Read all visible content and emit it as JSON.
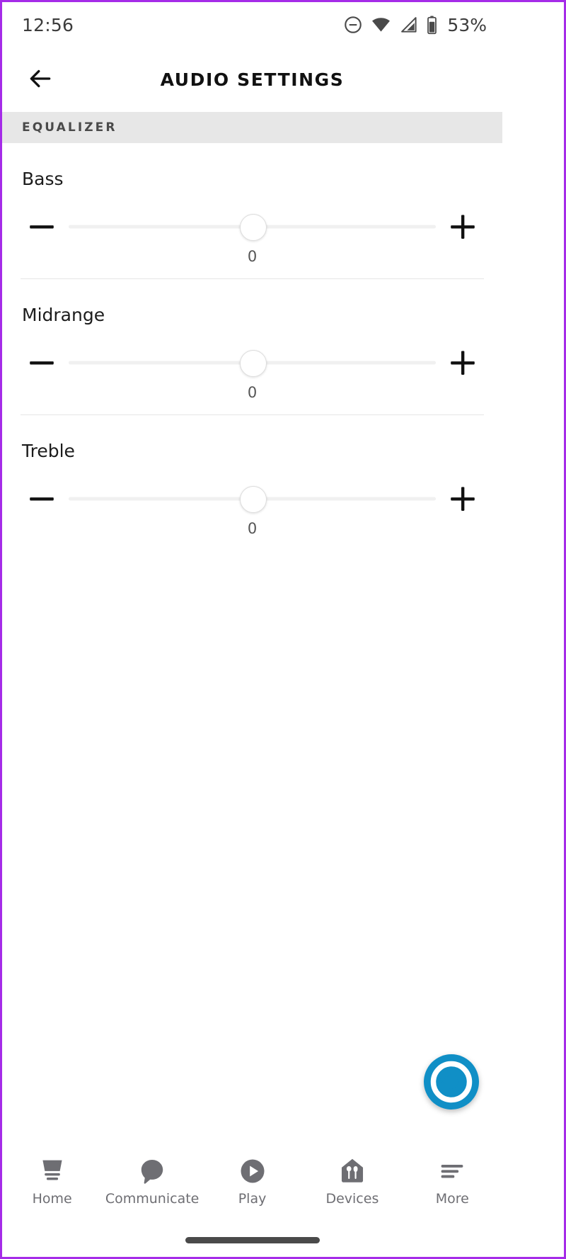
{
  "status_bar": {
    "time": "12:56",
    "battery_percent": "53%",
    "icons": [
      "do-not-disturb-icon",
      "wifi-icon",
      "cellular-signal-icon",
      "battery-icon"
    ]
  },
  "header": {
    "back_label": "back-arrow-icon",
    "title": "AUDIO SETTINGS"
  },
  "section": {
    "label": "EQUALIZER"
  },
  "equalizer": {
    "minus_symbol": "—",
    "plus_symbol": "+",
    "sliders": [
      {
        "label": "Bass",
        "value": "0",
        "percent": 50
      },
      {
        "label": "Midrange",
        "value": "0",
        "percent": 50
      },
      {
        "label": "Treble",
        "value": "0",
        "percent": 50
      }
    ]
  },
  "fab": {
    "name": "alexa-button",
    "color": "#108FC6"
  },
  "bottom_nav": {
    "items": [
      {
        "label": "Home",
        "icon": "home-icon"
      },
      {
        "label": "Communicate",
        "icon": "speech-bubble-icon"
      },
      {
        "label": "Play",
        "icon": "play-circle-icon"
      },
      {
        "label": "Devices",
        "icon": "devices-house-icon"
      },
      {
        "label": "More",
        "icon": "more-menu-icon"
      }
    ]
  },
  "colors": {
    "capture_border": "#A52BE8",
    "section_band": "#E7E7E7",
    "track": "#F0F0F0",
    "nav_inactive": "#6E6E73",
    "alexa_blue": "#108FC6"
  }
}
